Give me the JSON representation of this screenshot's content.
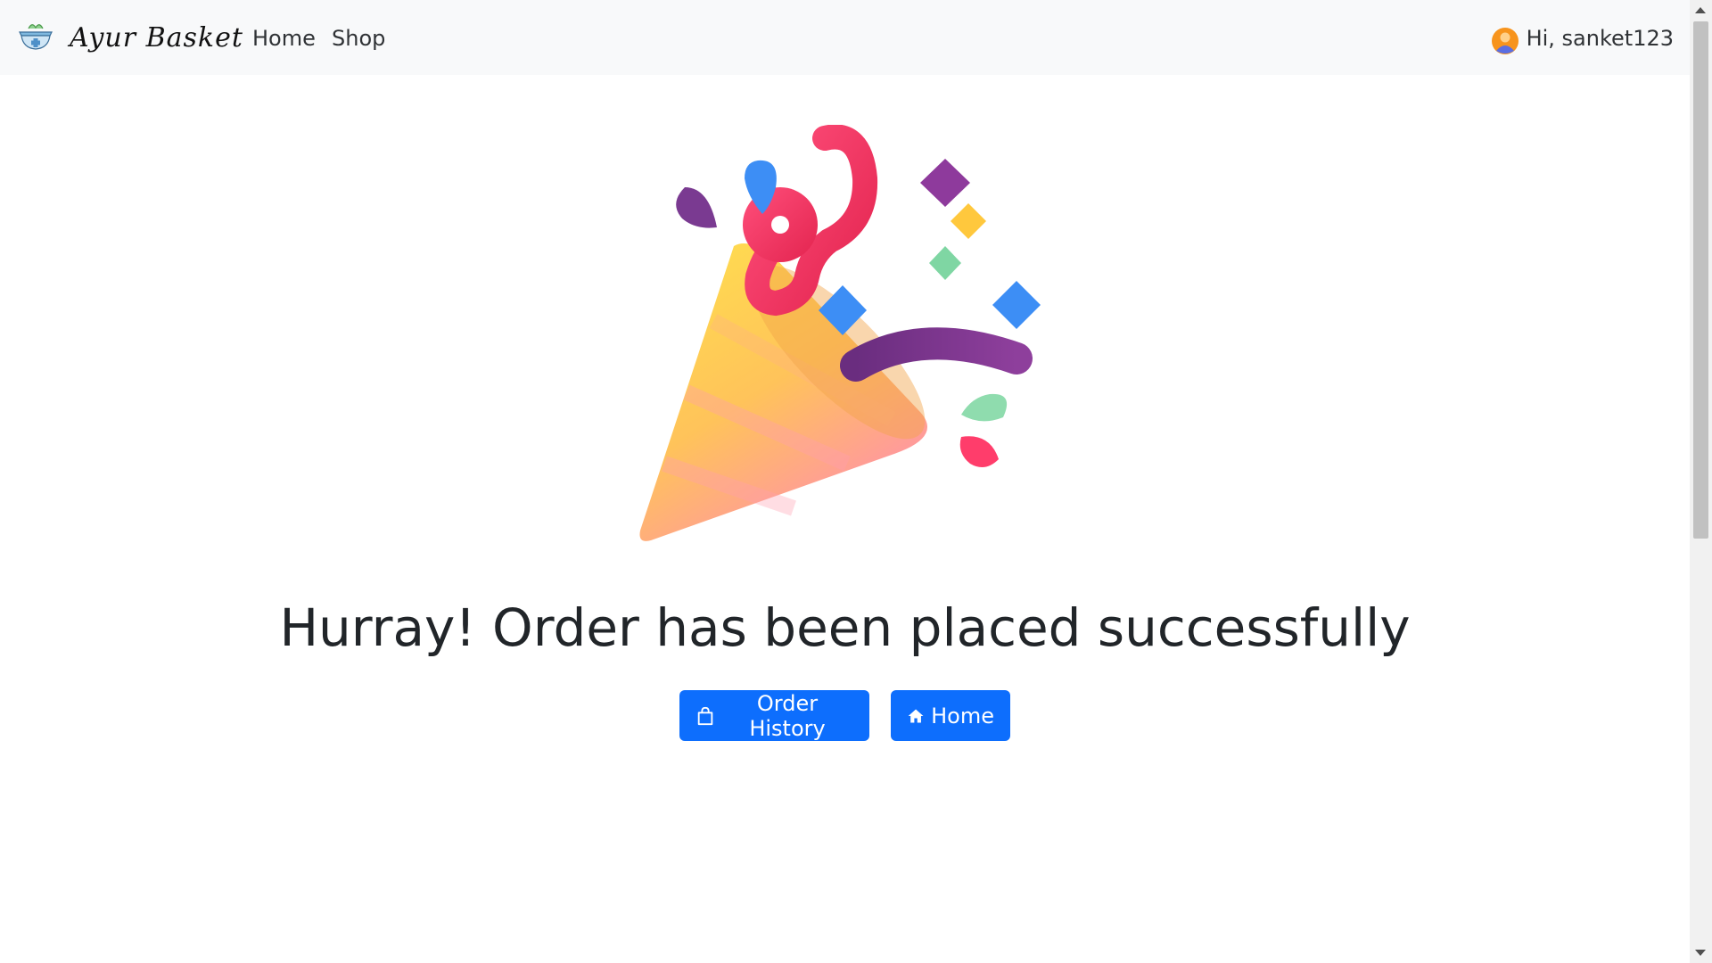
{
  "navbar": {
    "brand_name": "Ayur Basket",
    "brand_logo_icon": "basket-bowl-icon",
    "links": [
      {
        "label": "Home"
      },
      {
        "label": "Shop"
      }
    ],
    "user": {
      "avatar_icon": "user-avatar-icon",
      "greeting": "Hi, sanket123"
    }
  },
  "main": {
    "illustration_icon": "party-popper-icon",
    "headline": "Hurray! Order has been placed successfully",
    "buttons": {
      "order_history": {
        "label": "Order History",
        "icon": "shopping-bag-icon"
      },
      "home": {
        "label": "Home",
        "icon": "house-icon"
      }
    }
  },
  "colors": {
    "navbar_bg": "#f8f9fa",
    "primary": "#0d6efd",
    "text": "#212529"
  }
}
